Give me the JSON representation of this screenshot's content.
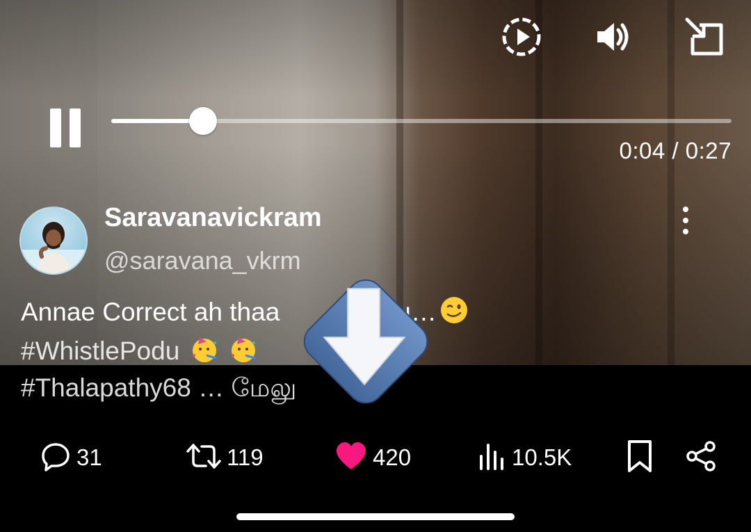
{
  "player": {
    "current_time": "0:04",
    "duration": "0:27",
    "time_separator": " / ",
    "progress_fraction": 0.148
  },
  "author": {
    "name": "Saravanavickram",
    "handle": "@saravana_vkrm"
  },
  "tweet": {
    "line1": "Annae Correct ah thaa",
    "line1_end": "kaaru…",
    "line2": "#WhistlePodu",
    "line3": "#Thalapathy68 … மேலு"
  },
  "actions": {
    "replies": "31",
    "retweets": "119",
    "likes": "420",
    "views": "10.5K"
  },
  "icons": {
    "top": [
      "autoplay-icon",
      "volume-icon",
      "minimize-icon"
    ],
    "actions": [
      "reply-icon",
      "retweet-icon",
      "like-icon",
      "views-icon",
      "bookmark-icon",
      "share-icon"
    ]
  },
  "colors": {
    "like": "#f91880",
    "background": "#000000",
    "download_badge": "#5a82b8"
  }
}
